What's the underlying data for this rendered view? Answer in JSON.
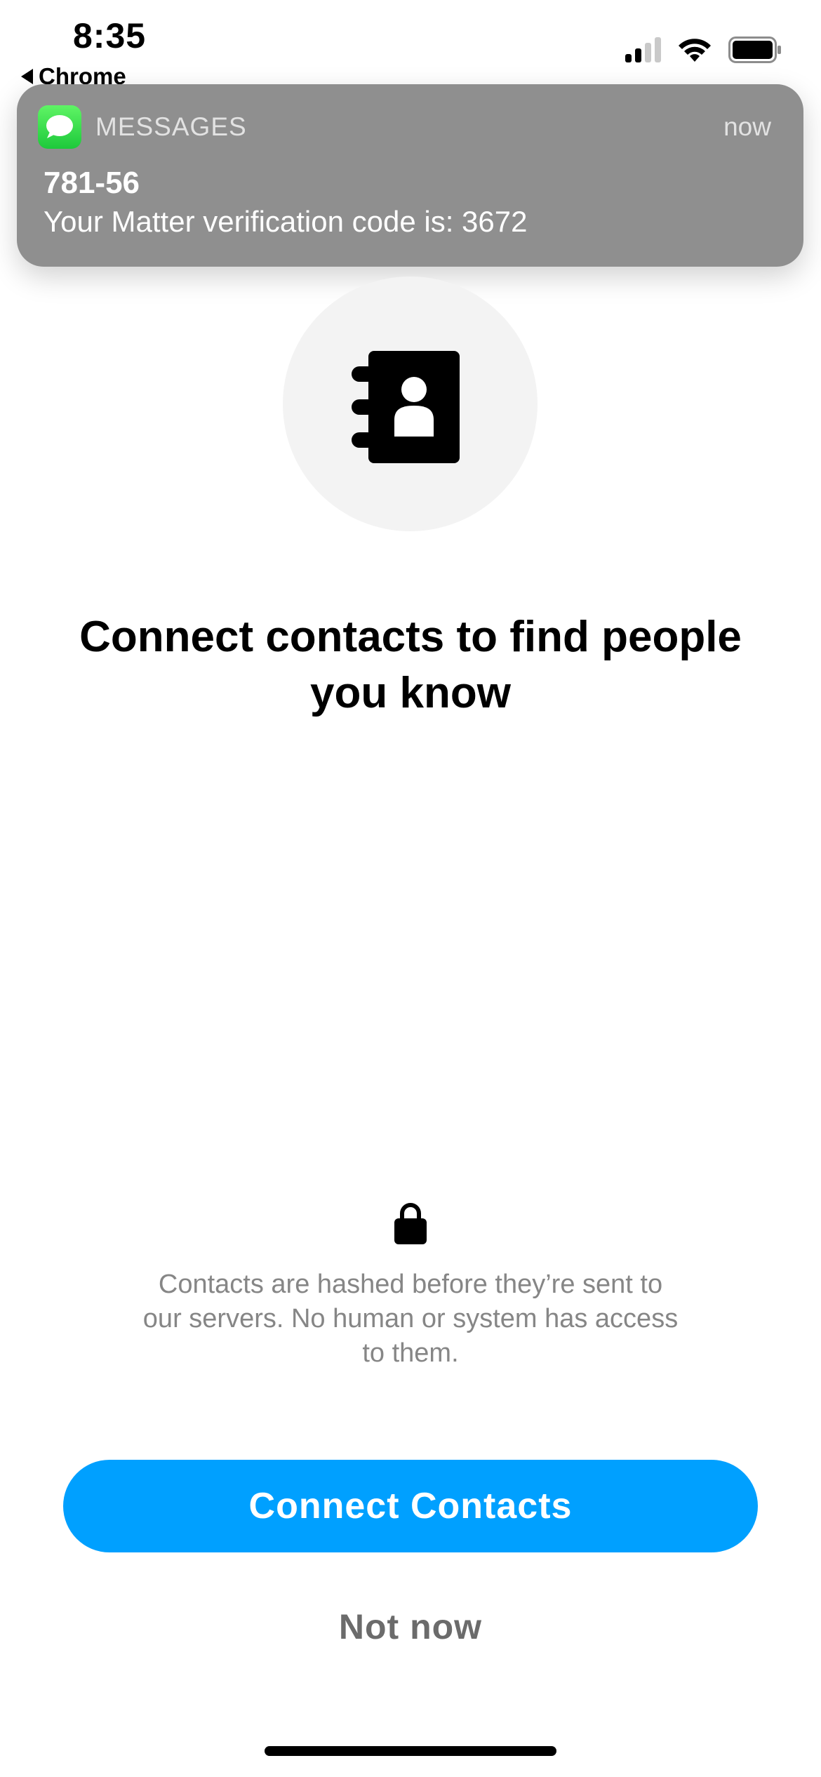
{
  "status_bar": {
    "time": "8:35",
    "back_app_label": "Chrome",
    "signal_icon": "cellular-signal-icon",
    "wifi_icon": "wifi-icon",
    "battery_icon": "battery-icon"
  },
  "notification": {
    "app_icon": "messages-icon",
    "app_name": "MESSAGES",
    "time": "now",
    "sender": "781-56",
    "body": "Your Matter verification code is: 3672"
  },
  "hero": {
    "icon": "address-book-icon"
  },
  "heading": "Connect contacts to find people you know",
  "privacy": {
    "icon": "lock-icon",
    "text": "Contacts are hashed before they’re sent to our servers. No human or system has access to them."
  },
  "actions": {
    "primary_label": "Connect Contacts",
    "secondary_label": "Not now"
  },
  "colors": {
    "accent": "#00A0FF",
    "notification_bg": "#8F8F8F",
    "muted_text": "#868686",
    "icon_circle_bg": "#F3F3F3"
  }
}
